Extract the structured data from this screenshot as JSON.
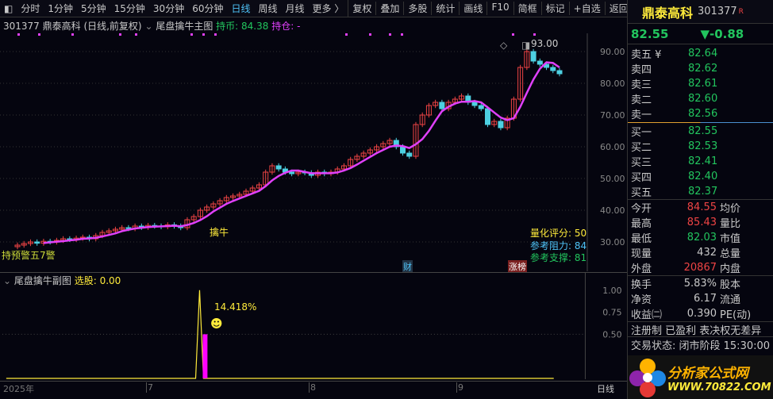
{
  "toolbar": {
    "periods": [
      "分时",
      "1分钟",
      "5分钟",
      "15分钟",
      "30分钟",
      "60分钟",
      "日线",
      "周线",
      "月线",
      "更多 〉"
    ],
    "active": "日线",
    "actions": [
      "复权",
      "叠加",
      "多股",
      "统计",
      "画线",
      "F10",
      "简框",
      "标记",
      "+自选",
      "返回"
    ]
  },
  "info": {
    "code_title": "301377 鼎泰高科 (日线,前复权)",
    "indicator": "尾盘擒牛主图",
    "hold_coin": "持币: 84.38",
    "hold_pos": "持仓: -"
  },
  "main_chart": {
    "price_labels": [
      "90.00",
      "80.00",
      "70.00",
      "60.00",
      "50.00",
      "40.00",
      "30.00"
    ],
    "high_mark": "93.00",
    "signal_label": "擒牛",
    "left_label": "持预警五7警",
    "badges": [
      "财",
      "涨榜"
    ],
    "score": "量化评分: 50",
    "resistance": "参考阻力: 84",
    "support": "参考支撑: 81"
  },
  "chart_data": {
    "type": "candlestick",
    "closes": [
      29,
      29.5,
      30,
      29.6,
      30.2,
      30,
      30.5,
      31,
      30.8,
      31.2,
      31.5,
      31,
      32,
      33,
      33.5,
      34,
      34.5,
      34.2,
      35,
      34.6,
      35.2,
      35,
      34.8,
      35.4,
      35,
      34.5,
      37,
      38,
      40,
      41,
      42,
      43,
      44,
      44.5,
      45,
      46,
      47,
      48,
      52,
      54,
      53,
      52,
      51.5,
      52,
      51.8,
      51,
      52,
      51.5,
      52,
      53,
      54,
      56,
      57,
      58,
      59,
      60,
      61,
      62,
      60,
      58,
      57,
      67,
      70,
      73,
      74,
      72,
      74,
      75,
      76,
      74,
      73,
      72,
      67,
      68,
      66,
      69,
      75,
      85,
      90,
      87,
      86,
      85,
      84,
      83
    ],
    "ylim": [
      22,
      97
    ],
    "ma_period": 5,
    "x_labels": [
      "2025年",
      "7",
      "8",
      "9",
      "日线"
    ]
  },
  "sub_chart": {
    "title": "尾盘擒牛副图",
    "select": "选股: 0.00",
    "pct": "14.418%",
    "axis": [
      "1.00",
      "0.75",
      "0.50"
    ],
    "signal_index": 28
  },
  "panel": {
    "name": "鼎泰高科",
    "code": "301377",
    "r": "R",
    "price": "82.55",
    "change": "▼-0.88",
    "asks": [
      {
        "l": "卖五 ¥",
        "v": "82.64"
      },
      {
        "l": "卖四",
        "v": "82.62"
      },
      {
        "l": "卖三",
        "v": "82.61"
      },
      {
        "l": "卖二",
        "v": "82.60"
      },
      {
        "l": "卖一",
        "v": "82.56"
      }
    ],
    "bids": [
      {
        "l": "买一",
        "v": "82.55"
      },
      {
        "l": "买二",
        "v": "82.53"
      },
      {
        "l": "买三",
        "v": "82.41"
      },
      {
        "l": "买四",
        "v": "82.40"
      },
      {
        "l": "买五",
        "v": "82.37"
      }
    ],
    "stats": [
      {
        "l": "今开",
        "v": "84.55",
        "c": "red",
        "r": "均价"
      },
      {
        "l": "最高",
        "v": "85.43",
        "c": "red",
        "r": "量比"
      },
      {
        "l": "最低",
        "v": "82.03",
        "c": "green",
        "r": "市值"
      },
      {
        "l": "现量",
        "v": "432",
        "c": "",
        "r": "总量"
      },
      {
        "l": "外盘",
        "v": "20867",
        "c": "red",
        "r": "内盘"
      }
    ],
    "stats2": [
      {
        "l": "换手",
        "v": "5.83%",
        "r": "股本"
      },
      {
        "l": "净资",
        "v": "6.17",
        "r": "流通"
      },
      {
        "l": "收益㈡",
        "v": "0.390",
        "r": "PE(动)"
      }
    ],
    "tags": "注册制 已盈利 表决权无差异",
    "status": "交易状态: 闭市阶段 15:30:00",
    "watermark": "分析家公式网 WWW.70822.COM"
  }
}
